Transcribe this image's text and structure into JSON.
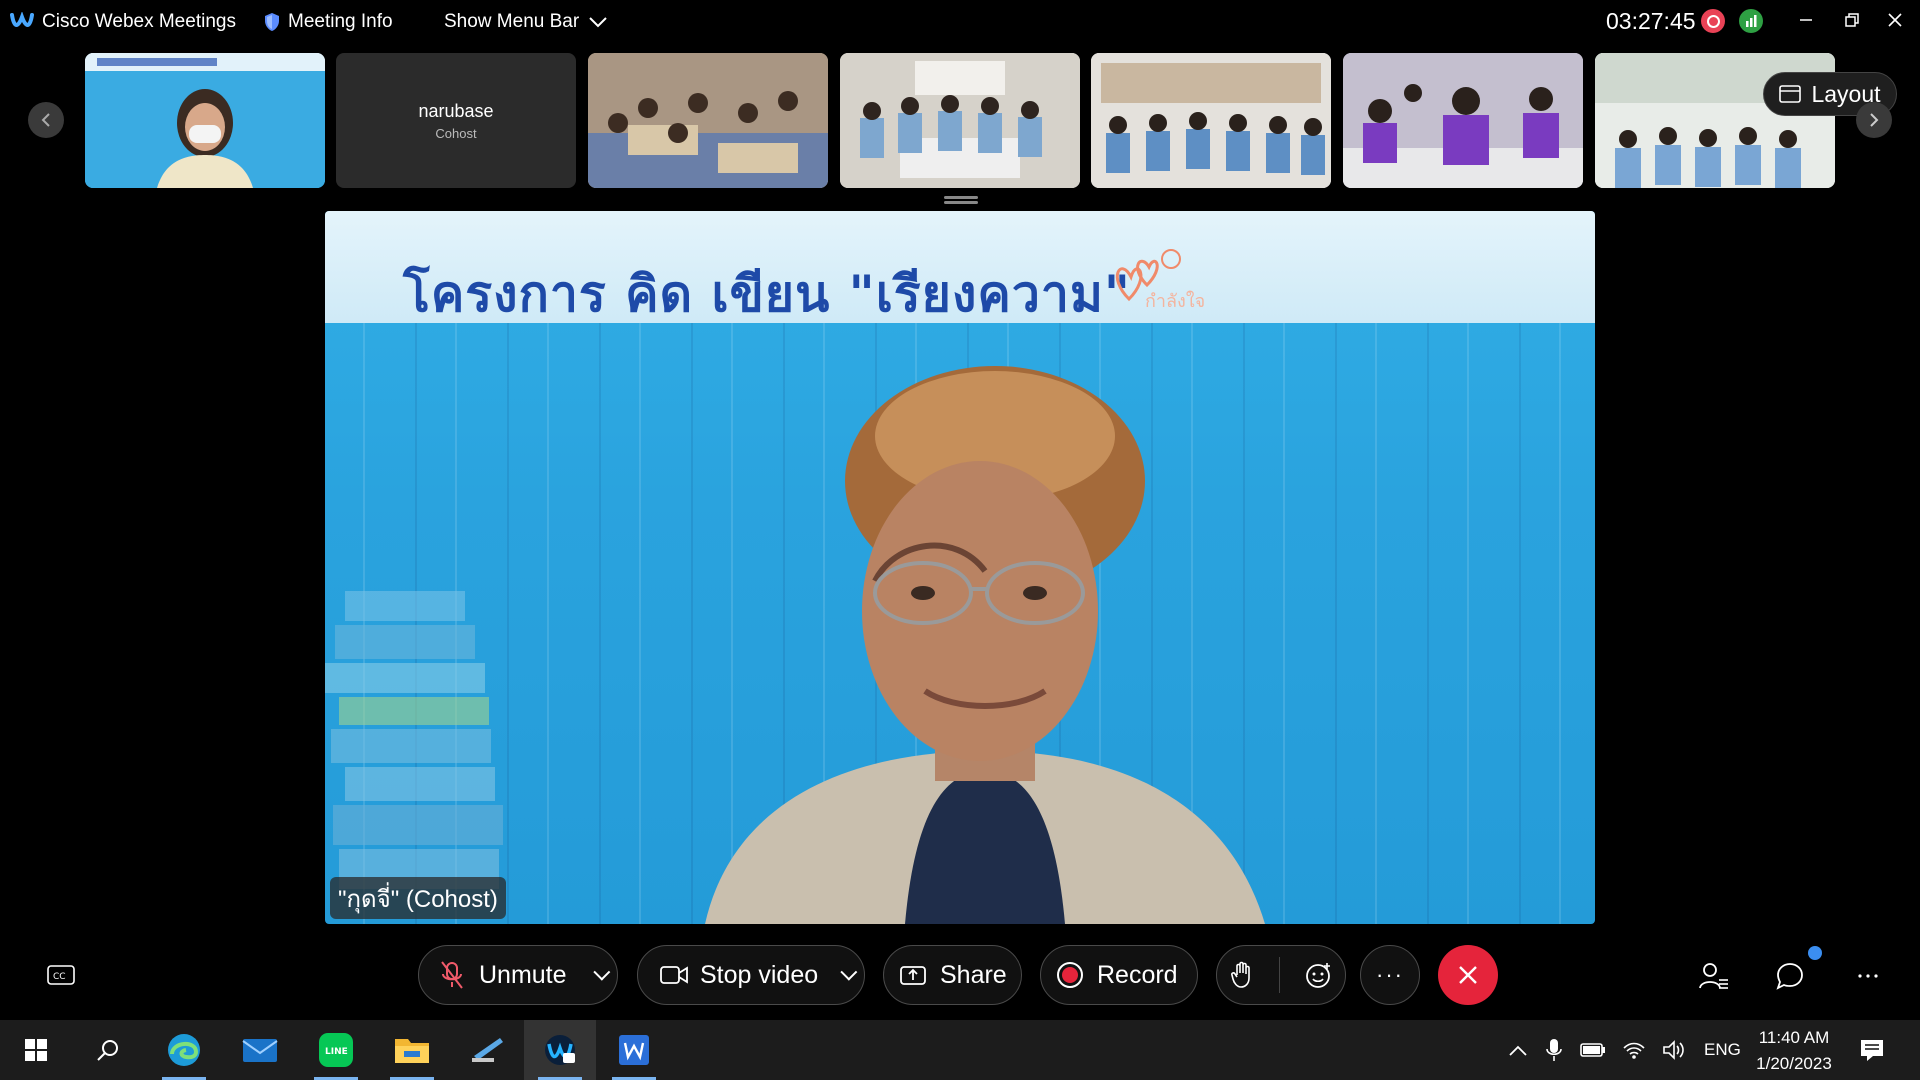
{
  "titlebar": {
    "app_title": "Cisco Webex Meetings",
    "meeting_info_label": "Meeting Info",
    "show_menu_label": "Show Menu Bar",
    "elapsed_time": "03:27:45",
    "window_controls": [
      "minimize-icon",
      "restore-icon",
      "close-icon"
    ]
  },
  "filmstrip": {
    "participants": [
      {
        "type": "video",
        "desc": "presenter-thumbnail"
      },
      {
        "type": "name",
        "name": "narubase",
        "role": "Cohost"
      },
      {
        "type": "video",
        "desc": "classroom-1"
      },
      {
        "type": "video",
        "desc": "classroom-2"
      },
      {
        "type": "video",
        "desc": "classroom-3"
      },
      {
        "type": "video",
        "desc": "classroom-4"
      },
      {
        "type": "video",
        "desc": "classroom-5"
      }
    ],
    "layout_label": "Layout"
  },
  "stage": {
    "banner_text": "โครงการ คิด เขียน \"เรียงความ\"",
    "speaker_label": "\"กุดจี่\" (Cohost)"
  },
  "controls": {
    "unmute_label": "Unmute",
    "stop_video_label": "Stop video",
    "share_label": "Share",
    "record_label": "Record",
    "more_label": "···",
    "accent_leave": "#e5243b",
    "accent_record": "#e5243b"
  },
  "taskbar": {
    "apps": [
      "windows-start-icon",
      "search-icon",
      "edge-icon",
      "mail-icon",
      "line-icon",
      "file-explorer-icon",
      "remote-desktop-icon",
      "webex-icon",
      "word-icon"
    ],
    "language": "ENG",
    "time": "11:40 AM",
    "date": "1/20/2023"
  }
}
